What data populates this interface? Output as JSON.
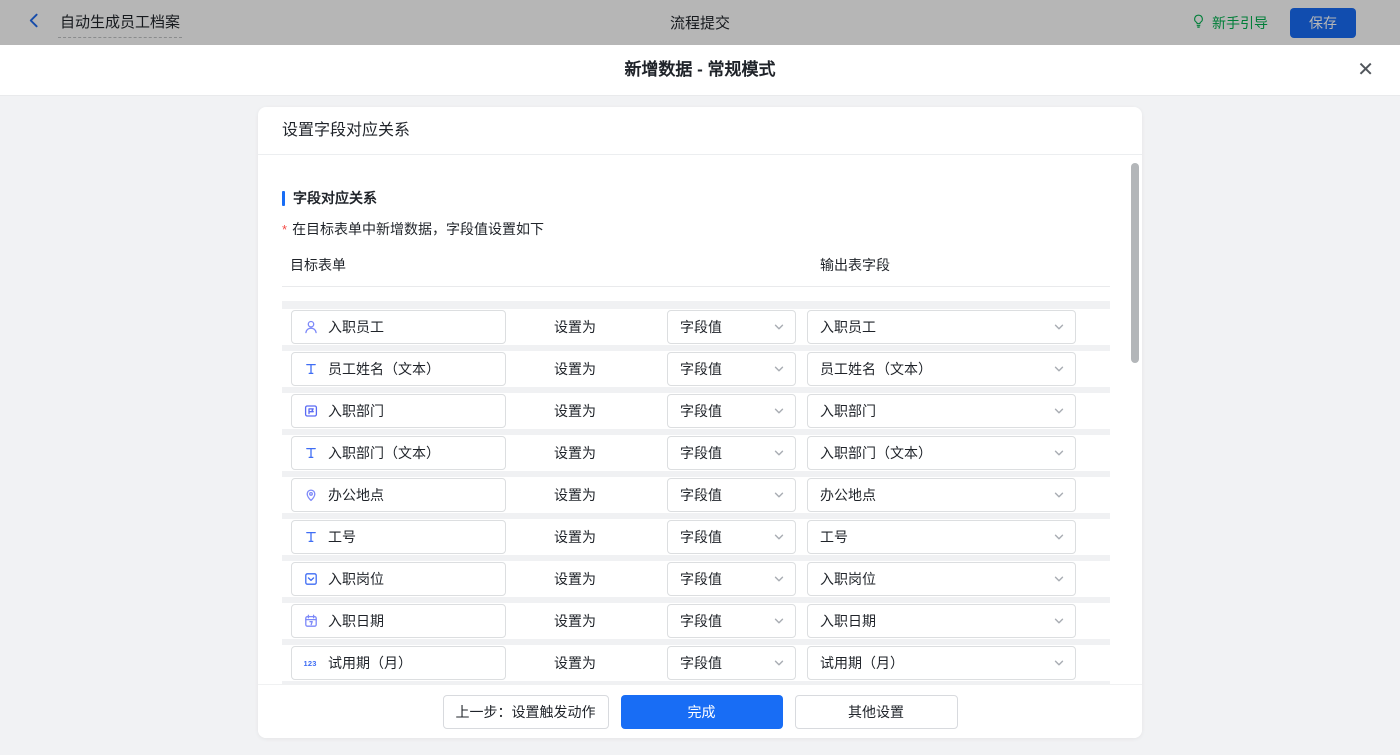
{
  "topbar": {
    "title": "自动生成员工档案",
    "center_title": "流程提交",
    "guide_label": "新手引导",
    "save_label": "保存"
  },
  "modal": {
    "title": "新增数据 - 常规模式",
    "close": "✕"
  },
  "panel": {
    "header": "设置字段对应关系",
    "section_title": "字段对应关系",
    "required_mark": "*",
    "required_note": "在目标表单中新增数据，字段值设置如下",
    "col_target": "目标表单",
    "col_output": "输出表字段",
    "set_as_label": "设置为",
    "rows": [
      {
        "icon": "member-icon",
        "field": "入职员工",
        "mode": "字段值",
        "output": "入职员工"
      },
      {
        "icon": "text-icon",
        "field": "员工姓名（文本）",
        "mode": "字段值",
        "output": "员工姓名（文本）"
      },
      {
        "icon": "department-icon",
        "field": "入职部门",
        "mode": "字段值",
        "output": "入职部门"
      },
      {
        "icon": "text-icon",
        "field": "入职部门（文本）",
        "mode": "字段值",
        "output": "入职部门（文本）"
      },
      {
        "icon": "location-icon",
        "field": "办公地点",
        "mode": "字段值",
        "output": "办公地点"
      },
      {
        "icon": "text-icon",
        "field": "工号",
        "mode": "字段值",
        "output": "工号"
      },
      {
        "icon": "select-icon",
        "field": "入职岗位",
        "mode": "字段值",
        "output": "入职岗位"
      },
      {
        "icon": "date-icon",
        "field": "入职日期",
        "mode": "字段值",
        "output": "入职日期"
      },
      {
        "icon": "number-icon",
        "field": "试用期（月）",
        "mode": "字段值",
        "output": "试用期（月）"
      },
      {
        "icon": "",
        "field": "",
        "mode": "",
        "output": ""
      }
    ],
    "footer": {
      "prev_label": "上一步：设置触发动作",
      "done_label": "完成",
      "other_label": "其他设置"
    }
  },
  "colors": {
    "brand_blue": "#186df5",
    "guide_green": "#00b14f",
    "icon_blue": "#3f6df4",
    "icon_periwinkle": "#7d89f9",
    "icon_indigo": "#5a6af3",
    "required_red": "#f54a45",
    "scrollbar": "#b3b6b9"
  }
}
